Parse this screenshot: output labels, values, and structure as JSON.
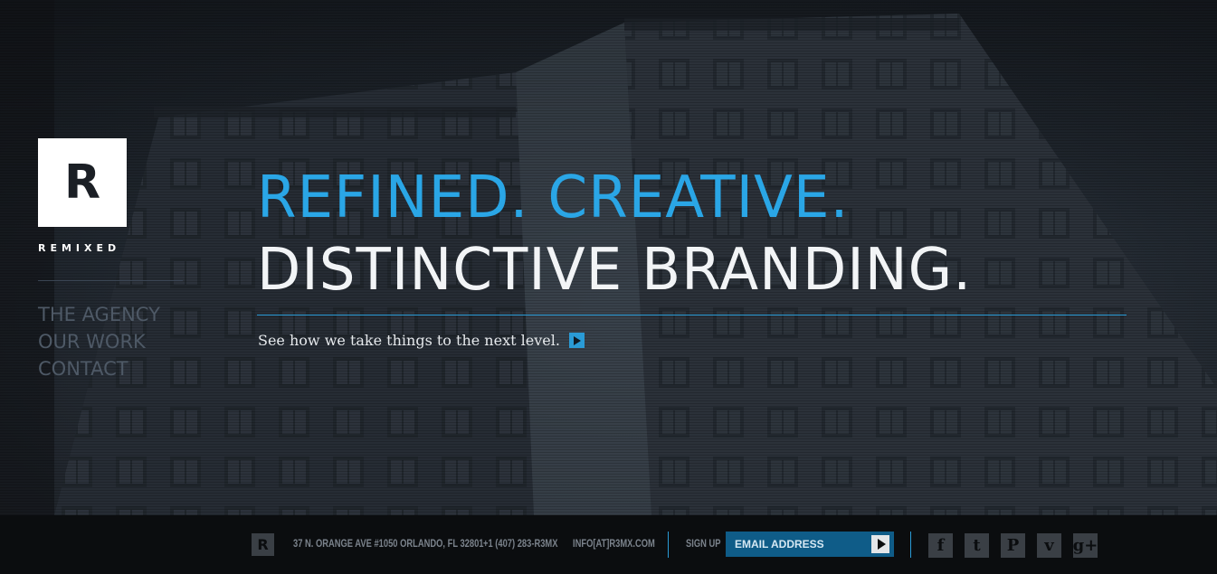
{
  "brand": {
    "logo_letter": "R",
    "wordmark": "REMIXED"
  },
  "nav": {
    "items": [
      {
        "label": "THE AGENCY"
      },
      {
        "label": "OUR WORK"
      },
      {
        "label": "CONTACT"
      }
    ]
  },
  "hero": {
    "headline_line1": "REFINED. CREATIVE.",
    "headline_line2": "DISTINCTIVE BRANDING.",
    "tagline": "See how we take things to the next level.",
    "accent_color": "#2aa6e6"
  },
  "footer": {
    "logo_letter": "R",
    "address": "37 N. ORANGE AVE #1050 ORLANDO, FL 32801",
    "phone": "+1 (407) 283-R3MX",
    "email": "INFO[AT]R3MX.COM",
    "signup_label": "SIGN UP",
    "email_placeholder": "EMAIL ADDRESS",
    "social": [
      {
        "icon": "facebook-icon",
        "glyph": "f"
      },
      {
        "icon": "twitter-icon",
        "glyph": "t"
      },
      {
        "icon": "pinterest-icon",
        "glyph": "P"
      },
      {
        "icon": "vimeo-icon",
        "glyph": "v"
      },
      {
        "icon": "google-plus-icon",
        "glyph": "g+"
      }
    ]
  }
}
